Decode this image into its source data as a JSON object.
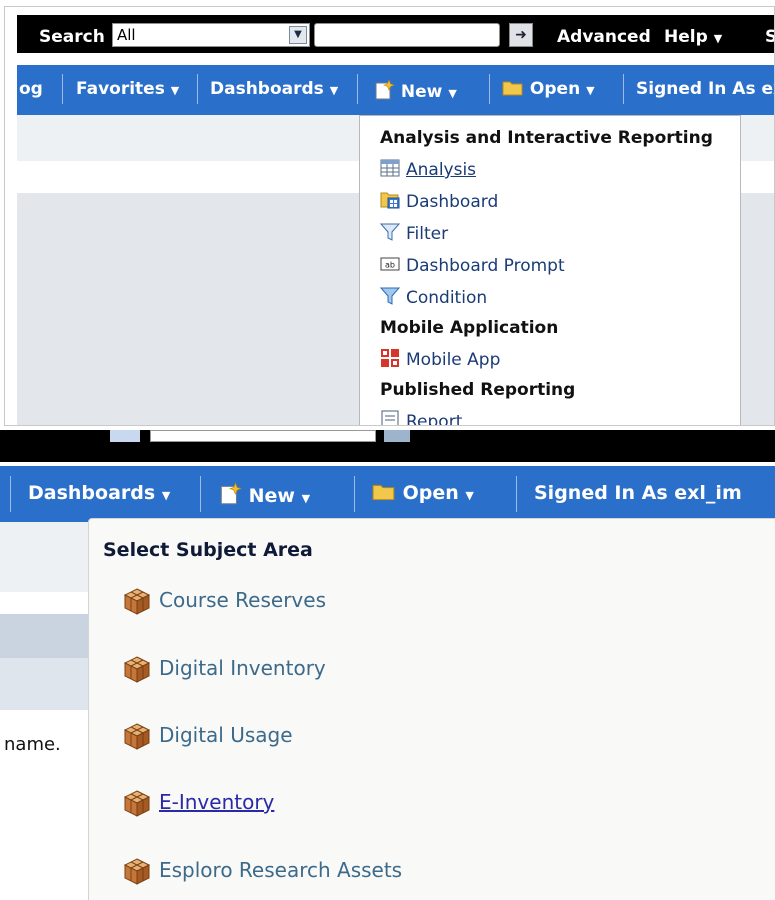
{
  "top": {
    "search_label": "Search",
    "search_scope": "All",
    "search_value": "",
    "advanced": "Advanced",
    "help": "Help",
    "sign": "Sig",
    "nav": {
      "catalog_partial": "og",
      "favorites": "Favorites",
      "dashboards": "Dashboards",
      "new": "New",
      "open": "Open",
      "signed_in": "Signed In As",
      "user_partial": "ex"
    },
    "dropdown": {
      "section1": "Analysis and Interactive Reporting",
      "analysis": "Analysis",
      "dashboard": "Dashboard",
      "filter": "Filter",
      "dashboard_prompt": "Dashboard Prompt",
      "condition": "Condition",
      "section2": "Mobile Application",
      "mobile_app": "Mobile App",
      "section3": "Published Reporting",
      "report": "Report"
    }
  },
  "bottom": {
    "nav": {
      "dashboards": "Dashboards",
      "new": "New",
      "open": "Open",
      "signed_in": "Signed In As",
      "user_partial": "exl_im"
    },
    "left_text": "name.",
    "subject_area": {
      "title": "Select Subject Area",
      "items": [
        {
          "label": "Course Reserves"
        },
        {
          "label": "Digital Inventory"
        },
        {
          "label": "Digital Usage"
        },
        {
          "label": "E-Inventory"
        },
        {
          "label": "Esploro Research Assets"
        }
      ]
    }
  },
  "colors": {
    "nav_blue": "#2a6fc9",
    "header_black": "#000000",
    "link_blue": "#2a2aa8"
  }
}
